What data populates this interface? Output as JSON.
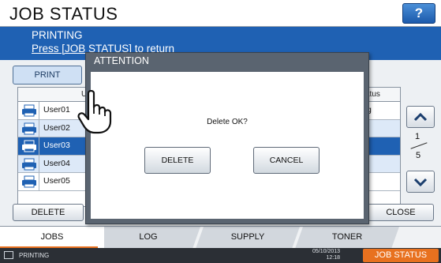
{
  "header": {
    "title": "JOB STATUS",
    "help_label": "?"
  },
  "status_band": {
    "line1": "PRINTING",
    "line2": "Press [JOB STATUS] to return"
  },
  "print_tab": "PRINT",
  "table": {
    "columns": [
      "U",
      "atus"
    ],
    "rows": [
      {
        "user": "User01",
        "status": "g",
        "selected": false
      },
      {
        "user": "User02",
        "status": "",
        "selected": false
      },
      {
        "user": "User03",
        "status": "",
        "selected": true
      },
      {
        "user": "User04",
        "status": "",
        "selected": false
      },
      {
        "user": "User05",
        "status": "",
        "selected": false
      }
    ]
  },
  "pager": {
    "current": "1",
    "total": "5"
  },
  "buttons": {
    "delete": "DELETE",
    "close": "CLOSE"
  },
  "tabs": [
    "JOBS",
    "LOG",
    "SUPPLY",
    "TONER"
  ],
  "bottom": {
    "status": "PRINTING",
    "date": "05/10/2013",
    "time": "12:18",
    "job_status": "JOB STATUS"
  },
  "dialog": {
    "title": "ATTENTION",
    "message": "Delete OK?",
    "confirm_label": "DELETE",
    "cancel_label": "CANCEL"
  },
  "colors": {
    "accent_blue": "#1f61b3",
    "accent_orange": "#e8711f",
    "modal_frame": "#5a6470"
  }
}
